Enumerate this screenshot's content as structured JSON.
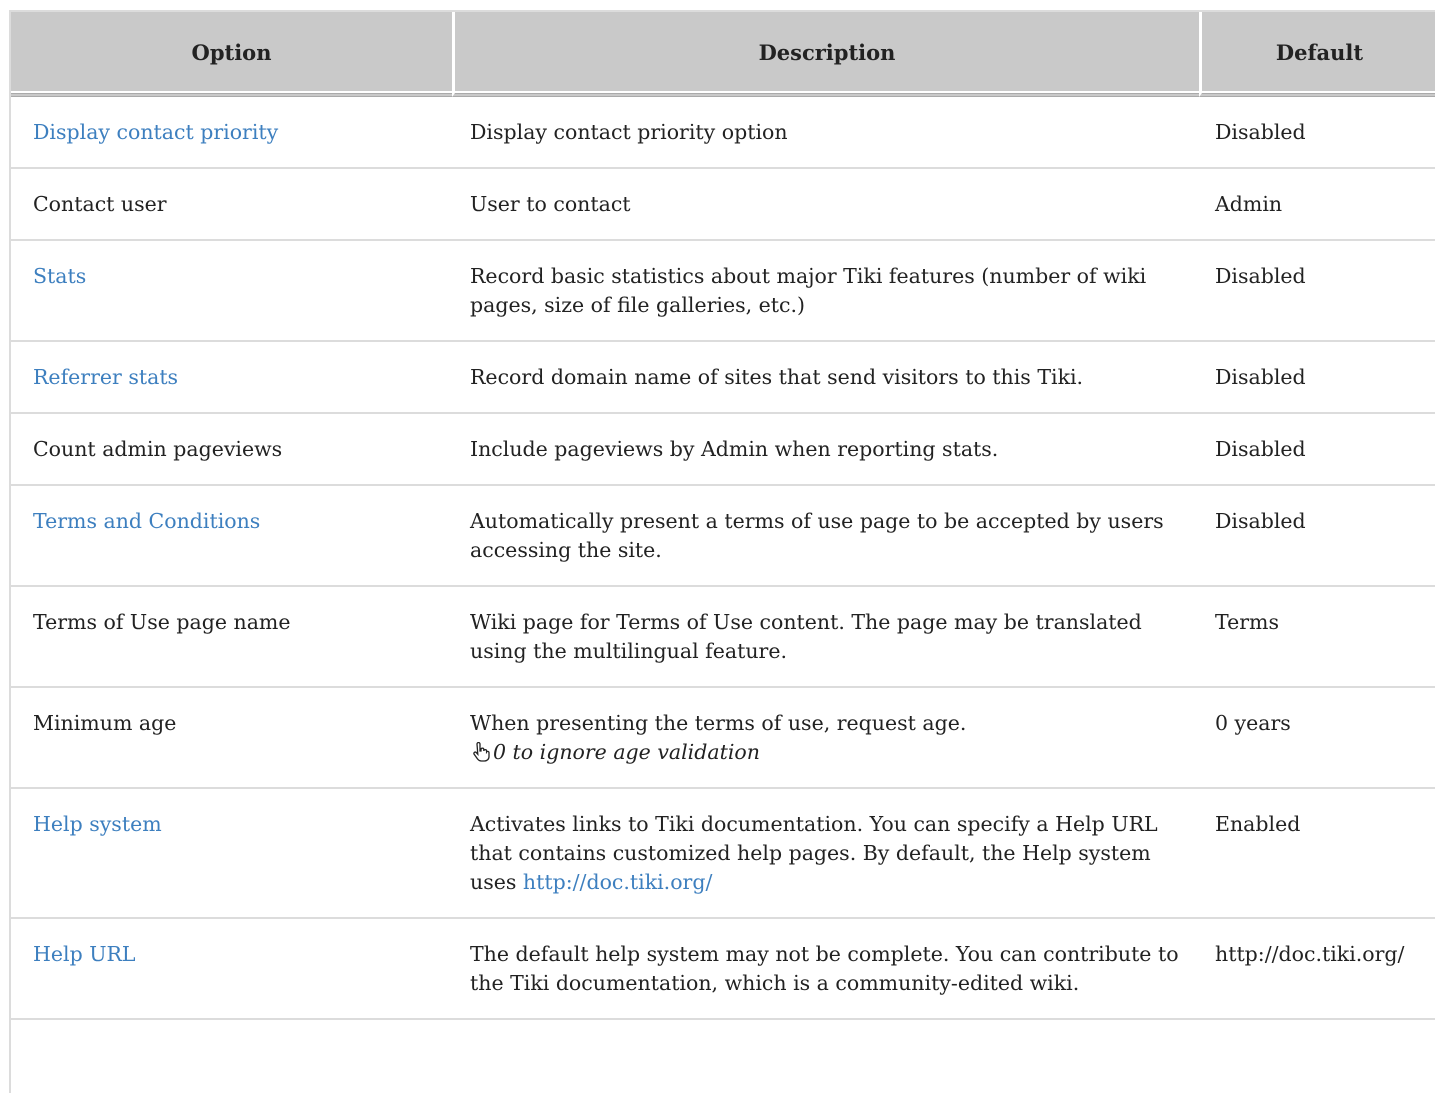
{
  "table": {
    "headers": [
      "Option",
      "Description",
      "Default"
    ],
    "rows": [
      {
        "option": "Display contact priority",
        "option_link": true,
        "description": "Display contact priority option",
        "default": "Disabled"
      },
      {
        "option": "Contact user",
        "option_link": false,
        "description": "User to contact",
        "default": "Admin"
      },
      {
        "option": "Stats",
        "option_link": true,
        "description": "Record basic statistics about major Tiki features (number of wiki pages, size of file galleries, etc.)",
        "default": "Disabled"
      },
      {
        "option": "Referrer stats",
        "option_link": true,
        "description": "Record domain name of sites that send visitors to this Tiki.",
        "default": "Disabled"
      },
      {
        "option": "Count admin pageviews",
        "option_link": false,
        "description": "Include pageviews by Admin when reporting stats.",
        "default": "Disabled"
      },
      {
        "option": "Terms and Conditions",
        "option_link": true,
        "description": "Automatically present a terms of use page to be accepted by users accessing the site.",
        "default": "Disabled"
      },
      {
        "option": "Terms of Use page name",
        "option_link": false,
        "description": "Wiki page for Terms of Use content. The page may be translated using the multilingual feature.",
        "default": "Terms"
      },
      {
        "option": "Minimum age",
        "option_link": false,
        "description": "When presenting the terms of use, request age.",
        "hint": "0 to ignore age validation",
        "hint_icon": "pointing-hand-icon",
        "default": "0 years"
      },
      {
        "option": "Help system",
        "option_link": true,
        "description": "Activates links to Tiki documentation. You can specify a Help URL that contains customized help pages. By default, the Help system uses",
        "description_link": "http://doc.tiki.org/",
        "default": "Enabled"
      },
      {
        "option": "Help URL",
        "option_link": true,
        "description": "The default help system may not be complete. You can contribute to the Tiki documentation, which is a community-edited wiki.",
        "default": "http://doc.tiki.org/"
      }
    ]
  },
  "colors": {
    "link": "#3d7fbf",
    "header_bg": "#c9c9c9",
    "border": "#dcdcdc",
    "text": "#222222"
  }
}
